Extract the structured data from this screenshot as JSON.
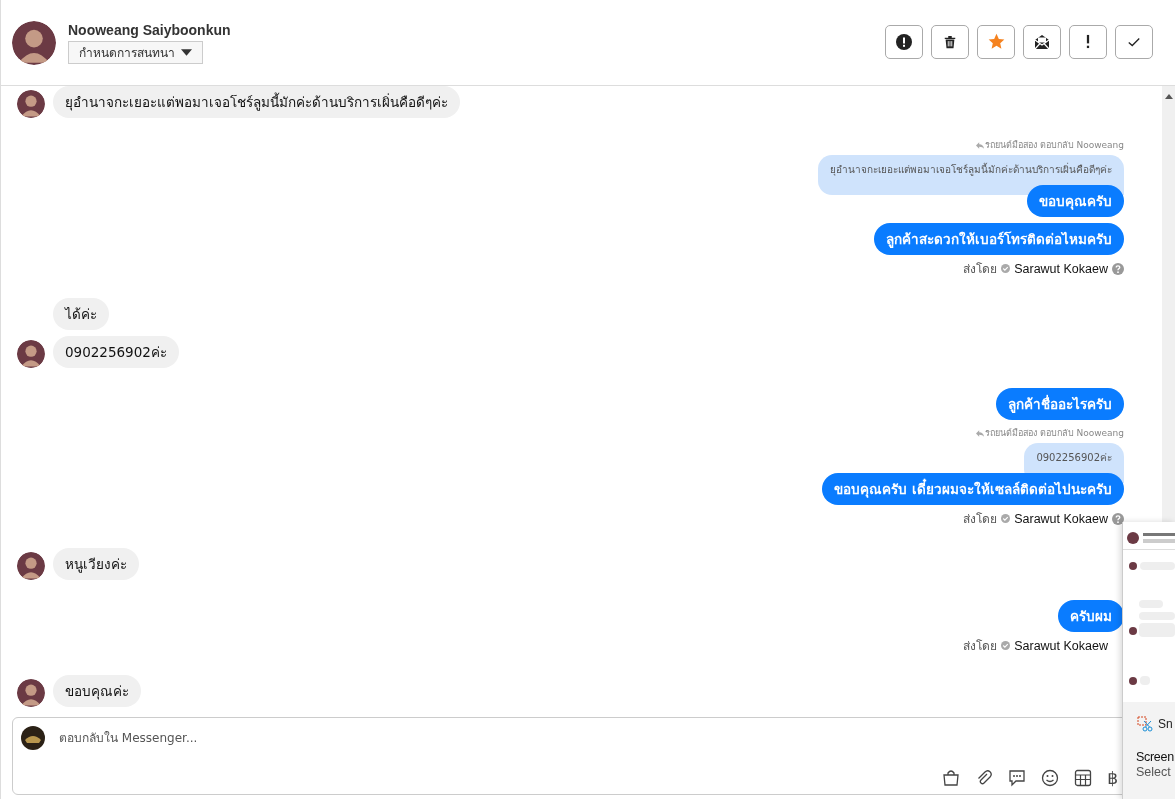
{
  "header": {
    "name": "Nooweang Saiyboonkun",
    "assign_button": "กำหนดการสนทนา"
  },
  "messages": [
    {
      "kind": "incoming",
      "text": "ยุอำนาจกะเยอะแต่พอมาเจอโชร์ลูมนี้มักค่ะด้านบริการเผิ่นคือดีๆค่ะ",
      "avatar": true
    },
    {
      "kind": "outgoing",
      "text": "ขอบคุณครับ",
      "reply": {
        "label": "รถยนต์มือสอง ตอบกลับ Nooweang",
        "quoted": "ยุอำนาจกะเยอะแต่พอมาเจอโชร์ลูมนี้มักค่ะด้านบริการเผิ่นคือดีๆค่ะ"
      }
    },
    {
      "kind": "outgoing",
      "text": "ลูกค้าสะดวกให้เบอร์โทรติดต่อไหมครับ",
      "sent_by": {
        "label": "ส่งโดย",
        "name": "Sarawut Kokaew",
        "help": true
      }
    },
    {
      "kind": "incoming",
      "text": "ได้ค่ะ",
      "avatar": false
    },
    {
      "kind": "incoming",
      "text": "0902256902ค่ะ",
      "avatar": true
    },
    {
      "kind": "outgoing",
      "text": "ลูกค้าชื่ออะไรครับ"
    },
    {
      "kind": "outgoing",
      "text": "ขอบคุณครับ เดี๋ยวผมจะให้เซลล์ติดต่อไปนะครับ",
      "reply": {
        "label": "รถยนต์มือสอง ตอบกลับ Nooweang",
        "quoted": "0902256902ค่ะ"
      },
      "sent_by": {
        "label": "ส่งโดย",
        "name": "Sarawut Kokaew",
        "help": true
      }
    },
    {
      "kind": "incoming",
      "text": "หนูเวียงค่ะ",
      "avatar": true
    },
    {
      "kind": "outgoing",
      "text": "ครับผม",
      "sent_by": {
        "label": "ส่งโดย",
        "name": "Sarawut Kokaew",
        "help": false
      }
    },
    {
      "kind": "incoming",
      "text": "ขอบคุณค่ะ",
      "avatar": true
    }
  ],
  "composer": {
    "placeholder": "ตอบกลับใน Messenger...",
    "currency": "฿"
  },
  "popup": {
    "app": "Sn",
    "title": "Screen",
    "subtitle": "Select"
  }
}
